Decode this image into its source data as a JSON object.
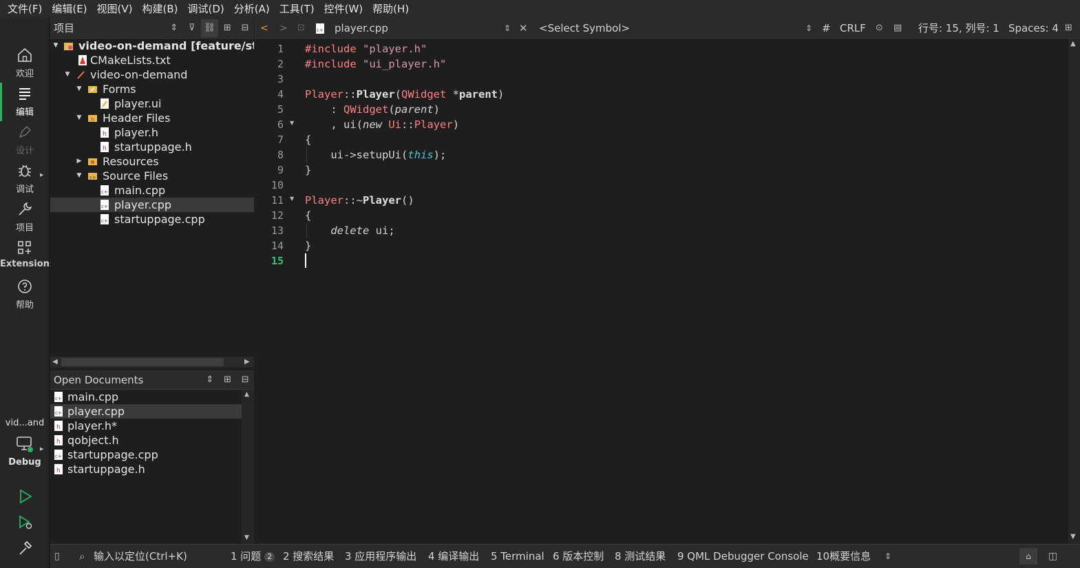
{
  "menubar": {
    "items": [
      "文件(F)",
      "编辑(E)",
      "视图(V)",
      "构建(B)",
      "调试(D)",
      "分析(A)",
      "工具(T)",
      "控件(W)",
      "帮助(H)"
    ]
  },
  "modes": {
    "welcome": "欢迎",
    "edit": "编辑",
    "design": "设计",
    "debug": "调试",
    "projects": "项目",
    "extensions": "Extensions",
    "help": "帮助"
  },
  "kit": {
    "name": "vid...and",
    "build": "Debug"
  },
  "project_panel": {
    "title": "项目",
    "tree": [
      "video-on-demand [feature/startu",
      "CMakeLists.txt",
      "video-on-demand",
      "Forms",
      "player.ui",
      "Header Files",
      "player.h",
      "startuppage.h",
      "Resources",
      "Source Files",
      "main.cpp",
      "player.cpp",
      "startuppage.cpp"
    ]
  },
  "open_documents": {
    "title": "Open Documents",
    "items": [
      "main.cpp",
      "player.cpp",
      "player.h*",
      "qobject.h",
      "startuppage.cpp",
      "startuppage.h"
    ]
  },
  "editor_toolbar": {
    "file": "player.cpp",
    "symbol": "<Select Symbol>",
    "hash": "#",
    "line_ending": "CRLF",
    "position": "行号: 15, 列号: 1",
    "indent": "Spaces: 4"
  },
  "editor": {
    "line_numbers": [
      "1",
      "2",
      "3",
      "4",
      "5",
      "6",
      "7",
      "8",
      "9",
      "10",
      "11",
      "12",
      "13",
      "14",
      "15"
    ],
    "current_line": "15",
    "code": {
      "l1_dir": "#include",
      "l1_str": "\"player.h\"",
      "l2_dir": "#include",
      "l2_str": "\"ui_player.h\"",
      "l4_class": "Player",
      "l4_sep": "::",
      "l4_fn": "Player",
      "l4_open": "(",
      "l4_type": "QWidget",
      "l4_star": " *",
      "l4_param": "parent",
      "l4_close": ")",
      "l5_colon": "    : ",
      "l5_base": "QWidget",
      "l5_open": "(",
      "l5_param": "parent",
      "l5_close": ")",
      "l6_comma": "    , ui(",
      "l6_new": "new",
      "l6_space": " ",
      "l6_ns": "Ui",
      "l6_sep": "::",
      "l6_cls": "Player",
      "l6_close": ")",
      "l7": "{",
      "l8_pre": "    ui->setupUi(",
      "l8_this": "this",
      "l8_post": ");",
      "l9": "}",
      "l11_class": "Player",
      "l11_sep": "::~",
      "l11_fn": "Player",
      "l11_parens": "()",
      "l12": "{",
      "l13_indent": "    ",
      "l13_kw": "delete",
      "l13_rest": " ui;",
      "l14": "}"
    }
  },
  "statusbar": {
    "locator": "输入以定位(Ctrl+K)",
    "tabs": [
      {
        "label": "1 问题",
        "badge": "2"
      },
      {
        "label": "2 搜索结果"
      },
      {
        "label": "3 应用程序输出"
      },
      {
        "label": "4 编译输出"
      },
      {
        "label": "5 Terminal"
      },
      {
        "label": "6 版本控制"
      },
      {
        "label": "8 测试结果"
      },
      {
        "label": "9 QML Debugger Console"
      },
      {
        "label": "10概要信息"
      }
    ]
  },
  "colors": {
    "accent_green": "#2fae62",
    "preprocessor": "#ff8080",
    "string": "#d69aa7",
    "this_keyword": "#45c6d6"
  }
}
